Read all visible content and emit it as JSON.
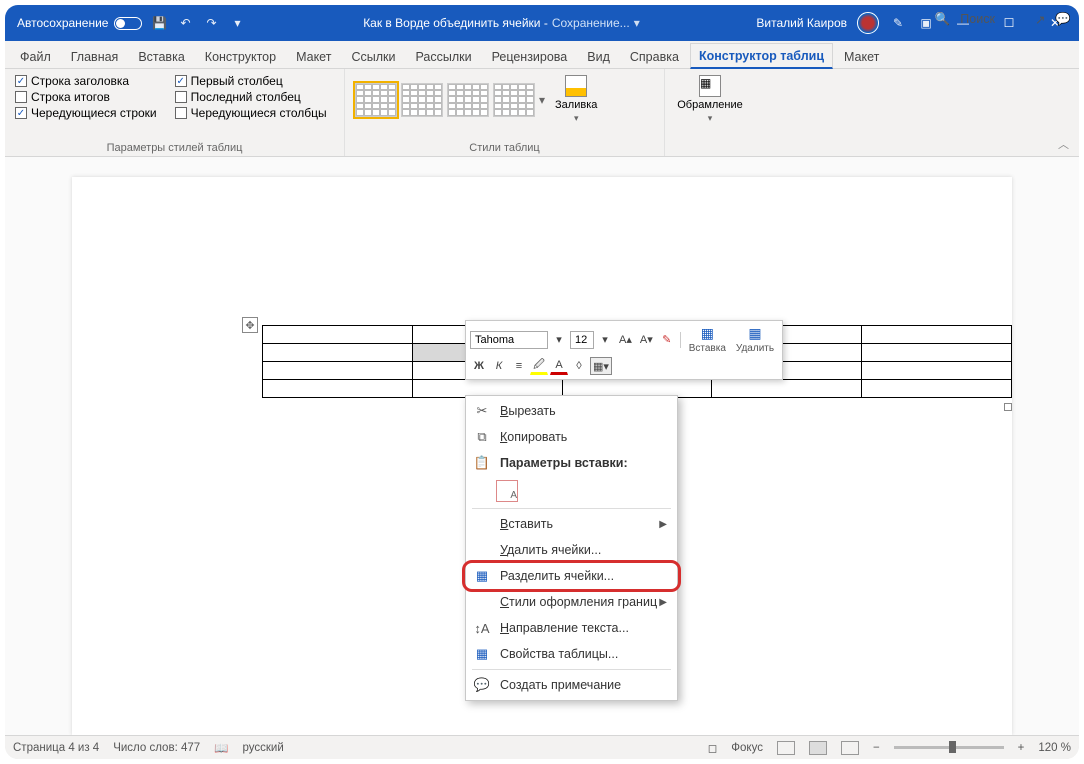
{
  "titlebar": {
    "autosave": "Автосохранение",
    "doc_title": "Как в Ворде объединить ячейки -",
    "saving": "Сохранение...",
    "user": "Виталий Каиров"
  },
  "tabs": {
    "file": "Файл",
    "home": "Главная",
    "insert": "Вставка",
    "design": "Конструктор",
    "layout": "Макет",
    "references": "Ссылки",
    "mailings": "Рассылки",
    "review": "Рецензирова",
    "view": "Вид",
    "help": "Справка",
    "table_design": "Конструктор таблиц",
    "table_layout": "Макет",
    "search": "Поиск"
  },
  "ribbon": {
    "opts": {
      "header_row": "Строка заголовка",
      "total_row": "Строка итогов",
      "banded_rows": "Чередующиеся строки",
      "first_col": "Первый столбец",
      "last_col": "Последний столбец",
      "banded_cols": "Чередующиеся столбцы",
      "group_label": "Параметры стилей таблиц"
    },
    "styles_label": "Стили таблиц",
    "fill": "Заливка",
    "borders": "Обрамление"
  },
  "mini": {
    "font": "Tahoma",
    "size": "12",
    "bold": "Ж",
    "italic": "К",
    "insert": "Вставка",
    "delete": "Удалить"
  },
  "ctx": {
    "cut": "Вырезать",
    "copy": "Копировать",
    "paste_opts": "Параметры вставки:",
    "insert": "Вставить",
    "delete_cells": "Удалить ячейки...",
    "split_cells": "Разделить ячейки...",
    "border_styles": "Стили оформления границ",
    "text_direction": "Направление текста...",
    "table_props": "Свойства таблицы...",
    "new_comment": "Создать примечание"
  },
  "status": {
    "page": "Страница 4 из 4",
    "words": "Число слов: 477",
    "lang": "русский",
    "focus": "Фокус",
    "zoom": "120 %"
  }
}
